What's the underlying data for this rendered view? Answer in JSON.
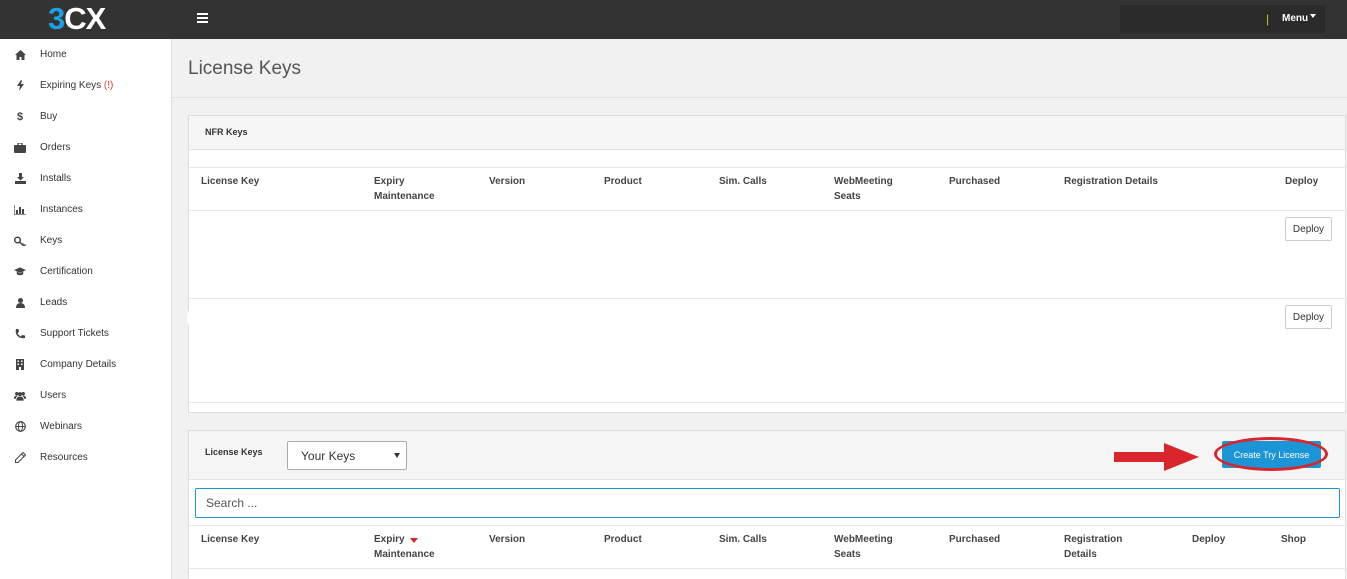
{
  "app": {
    "logo_part1": "3",
    "logo_part2": "CX",
    "menu_label": "Menu",
    "user_separator": "|"
  },
  "sidebar": {
    "items": [
      {
        "label": "Home",
        "icon": "home-icon"
      },
      {
        "label": "Expiring Keys",
        "warning": "(!)",
        "icon": "bolt-icon"
      },
      {
        "label": "Buy",
        "icon": "dollar-icon"
      },
      {
        "label": "Orders",
        "icon": "briefcase-icon"
      },
      {
        "label": "Installs",
        "icon": "download-icon"
      },
      {
        "label": "Instances",
        "icon": "bar-chart-icon"
      },
      {
        "label": "Keys",
        "icon": "key-icon"
      },
      {
        "label": "Certification",
        "icon": "graduation-cap-icon"
      },
      {
        "label": "Leads",
        "icon": "user-icon"
      },
      {
        "label": "Support Tickets",
        "icon": "phone-icon"
      },
      {
        "label": "Company Details",
        "icon": "building-icon"
      },
      {
        "label": "Users",
        "icon": "users-icon"
      },
      {
        "label": "Webinars",
        "icon": "globe-icon"
      },
      {
        "label": "Resources",
        "icon": "pencil-icon"
      }
    ]
  },
  "main": {
    "page_title": "License Keys",
    "nfr_panel": {
      "title": "NFR Keys",
      "columns": [
        {
          "label": "License Key"
        },
        {
          "label": "Expiry Maintenance"
        },
        {
          "label": "Version"
        },
        {
          "label": "Product"
        },
        {
          "label": "Sim. Calls"
        },
        {
          "label": "WebMeeting Seats"
        },
        {
          "label": "Purchased"
        },
        {
          "label": "Registration Details"
        },
        {
          "label": "Deploy"
        }
      ],
      "rows": [
        {
          "deploy_label": "Deploy"
        },
        {
          "deploy_label": "Deploy"
        }
      ]
    },
    "license_panel": {
      "title": "License Keys",
      "filter_selected": "Your Keys",
      "create_button": "Create Try License",
      "search_placeholder": "Search ...",
      "columns": [
        {
          "label": "License Key"
        },
        {
          "label": "Expiry Maintenance",
          "sorted": "desc"
        },
        {
          "label": "Version"
        },
        {
          "label": "Product"
        },
        {
          "label": "Sim. Calls"
        },
        {
          "label": "WebMeeting Seats"
        },
        {
          "label": "Purchased"
        },
        {
          "label": "Registration Details"
        },
        {
          "label": "Deploy"
        },
        {
          "label": "Shop"
        }
      ]
    }
  },
  "colors": {
    "topbar": "#333333",
    "accent_blue": "#1b95d5",
    "annotation_red": "#d9262c",
    "warning_red": "#e53935"
  }
}
